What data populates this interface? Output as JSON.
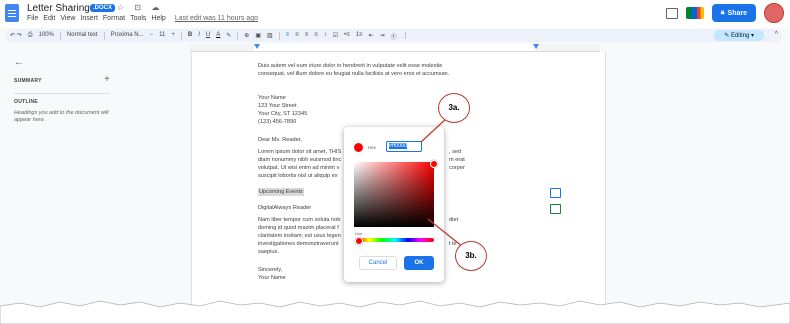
{
  "header": {
    "title": "Letter Sharing-A",
    "badge": ".DOCX",
    "title_icons": "☆ ⊡ ☁",
    "menus": [
      "File",
      "Edit",
      "View",
      "Insert",
      "Format",
      "Tools",
      "Help"
    ],
    "last_edit": "Last edit was 11 hours ago",
    "share_label": "Share",
    "share_icon": "lock-icon"
  },
  "toolbar": {
    "undo_redo": "↶ ↷",
    "zoom": "100%",
    "style": "Normal text",
    "font": "Proxima N...",
    "minus": "−",
    "font_size": "11",
    "plus": "+",
    "bold": "B",
    "italic": "I",
    "underline": "U",
    "text_color": "A",
    "more": "⋮",
    "editing_label": "Editing",
    "collapse": "^"
  },
  "sidebar": {
    "back_icon": "←",
    "summary_label": "SUMMARY",
    "summary_add": "+",
    "outline_label": "OUTLINE",
    "outline_hint": "Headings you add to the document will appear here."
  },
  "document": {
    "lines_top": [
      "Duis autem vel eum iriure dolor in hendrerit in vulputate velit esse molestie",
      "consequat, vel illum dolore eu feugiat nulla facilisis at vero eros et accumsan."
    ],
    "address": [
      "Your Name",
      "123 Your Street",
      "Your City, ST 12345",
      "(123) 456-7890"
    ],
    "greeting": "Dear Ms. Reader,",
    "para_left": [
      "Lorem ipsum dolor sit amet, THIS",
      "diam nonummy nibh euismod tinc",
      "volutpat. Ut wisi enim ad minim v",
      "suscipit lobortis nisl ut aliquip ex"
    ],
    "para_right": [
      ", sed",
      "m erat",
      "corper",
      ""
    ],
    "highlighted": "Upcoming Events",
    "digital": "DigitalAlways Reader",
    "para2_left": [
      "Nam liber tempor cum soluta nob",
      "doming id quod mazim placerat f",
      "claritatem insitam; est usus legen",
      "investigationes demonstraverunt",
      "saepius."
    ],
    "para2_right": [
      "diet",
      "",
      "",
      "t le",
      ""
    ],
    "closing": [
      "Sincerely,",
      "Your Name"
    ]
  },
  "color_dialog": {
    "hex_label": "Hex",
    "hex_value": "#ff0000",
    "hue_label": "Hue",
    "cancel_label": "Cancel",
    "ok_label": "OK",
    "selected_color": "#ff0000"
  },
  "callouts": {
    "a": "3a.",
    "b": "3b."
  },
  "colors": {
    "accent": "#1a73e8",
    "callout_border": "#c0392b"
  }
}
